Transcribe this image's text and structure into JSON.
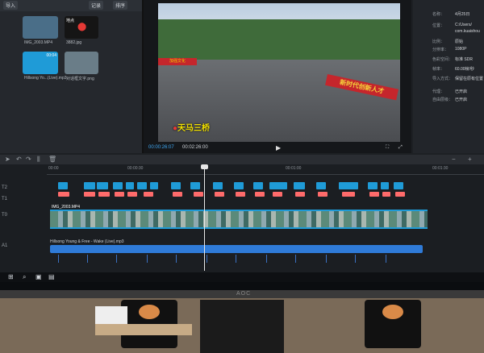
{
  "media": {
    "toolbar": [
      "导入",
      "记录",
      "排序"
    ],
    "items": [
      {
        "name": "IMG_2003.MP4"
      },
      {
        "name": "地点"
      },
      {
        "name": "3882.jpg"
      },
      {
        "name": "00:04"
      },
      {
        "name": "Hillsong Yo...(Live).mp3"
      },
      {
        "name": "对话框文字.png"
      }
    ]
  },
  "preview": {
    "location_text": "天马三桥",
    "banner_left": "加强文化",
    "banner_right": "新时代创新人才",
    "timecode_current": "00:00:26:07",
    "timecode_total": "00:02:26:00"
  },
  "properties": {
    "rows": [
      {
        "label": "名称：",
        "value": "4月25日"
      },
      {
        "label": "位置：",
        "value": "C:/Users/"
      },
      {
        "label": "",
        "value": "com.kuaishou"
      },
      {
        "label": "比例：",
        "value": "原始"
      },
      {
        "label": "分辨率：",
        "value": "1080P"
      },
      {
        "label": "色彩空间：",
        "value": "标准 SDR"
      },
      {
        "label": "帧率：",
        "value": "60.00帧/秒"
      },
      {
        "label": "导入方式：",
        "value": "保留在原有位置"
      },
      {
        "label": "代理：",
        "value": "已开启"
      },
      {
        "label": "自由层级：",
        "value": "已开启"
      }
    ]
  },
  "timeline": {
    "ruler": [
      "00:00",
      "00:00:30",
      "00:01:00",
      "00:01:30"
    ],
    "tracks": [
      "T2",
      "T1",
      "T0",
      "A1"
    ],
    "strip_label": "IMG_2003.MP4",
    "audio_label": "Hillsong Young & Free - Wake (Live).mp3"
  },
  "monitor": {
    "brand": "AOC"
  }
}
